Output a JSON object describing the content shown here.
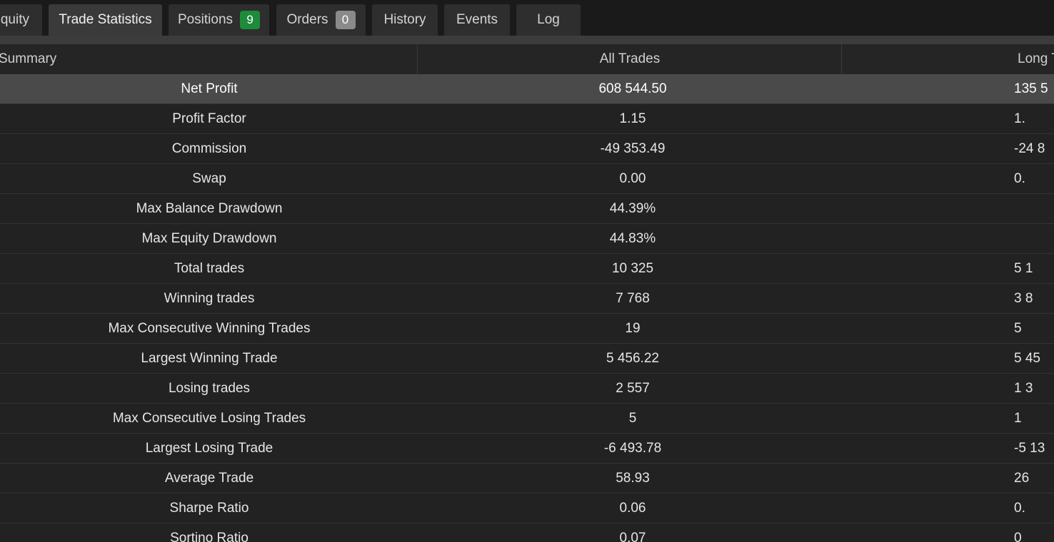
{
  "tabs": [
    {
      "label": "quity",
      "active": false
    },
    {
      "label": "Trade Statistics",
      "active": true
    },
    {
      "label": "Positions",
      "badge": "9",
      "active": false
    },
    {
      "label": "Orders",
      "badge": "0",
      "active": false
    },
    {
      "label": "History",
      "active": false
    },
    {
      "label": "Events",
      "active": false
    },
    {
      "label": "Log",
      "active": false
    }
  ],
  "colors": {
    "positions_badge": "#1e8a3c",
    "orders_badge": "#8a8a8a",
    "highlight_row": "#4a4a4a"
  },
  "table": {
    "headers": {
      "summary": "Summary",
      "all": "All Trades",
      "long": "Long T"
    },
    "rows": [
      {
        "label": "Net Profit",
        "all": "608 544.50",
        "long": "135 5",
        "highlight": true
      },
      {
        "label": "Profit Factor",
        "all": "1.15",
        "long": "1."
      },
      {
        "label": "Commission",
        "all": "-49 353.49",
        "long": "-24 8"
      },
      {
        "label": "Swap",
        "all": "0.00",
        "long": "0."
      },
      {
        "label": "Max Balance Drawdown",
        "all": "44.39%",
        "long": ""
      },
      {
        "label": "Max Equity Drawdown",
        "all": "44.83%",
        "long": ""
      },
      {
        "label": "Total trades",
        "all": "10 325",
        "long": "5 1"
      },
      {
        "label": "Winning trades",
        "all": "7 768",
        "long": "3 8"
      },
      {
        "label": "Max Consecutive Winning Trades",
        "all": "19",
        "long": "5"
      },
      {
        "label": "Largest Winning Trade",
        "all": "5 456.22",
        "long": "5 45"
      },
      {
        "label": "Losing trades",
        "all": "2 557",
        "long": "1 3"
      },
      {
        "label": "Max Consecutive Losing Trades",
        "all": "5",
        "long": "1"
      },
      {
        "label": "Largest Losing Trade",
        "all": "-6 493.78",
        "long": "-5 13"
      },
      {
        "label": "Average Trade",
        "all": "58.93",
        "long": "26"
      },
      {
        "label": "Sharpe Ratio",
        "all": "0.06",
        "long": "0."
      },
      {
        "label": "Sortino Ratio",
        "all": "0.07",
        "long": "0"
      }
    ]
  }
}
